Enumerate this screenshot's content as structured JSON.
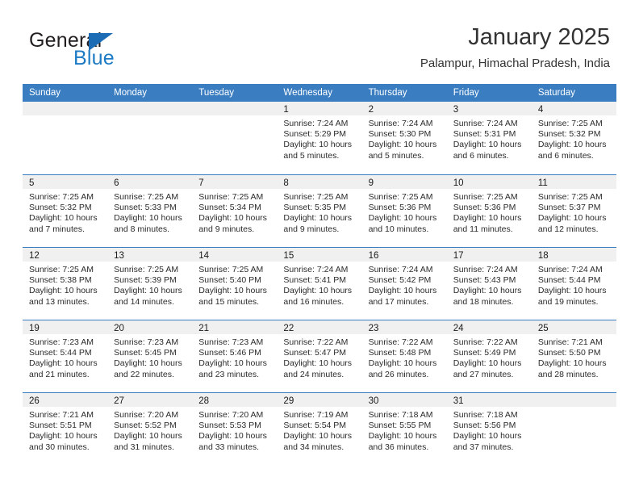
{
  "brand": {
    "name_part1": "General",
    "name_part2": "Blue",
    "triangle_color": "#1b6bb5",
    "blue_color": "#1c7bc4"
  },
  "header": {
    "month_title": "January 2025",
    "location": "Palampur, Himachal Pradesh, India"
  },
  "theme": {
    "header_blue": "#3a7dc1",
    "date_band_gray": "#f0f0f0",
    "text_color": "#2b2b2b"
  },
  "weekdays": [
    "Sunday",
    "Monday",
    "Tuesday",
    "Wednesday",
    "Thursday",
    "Friday",
    "Saturday"
  ],
  "weeks": [
    [
      {
        "date": "",
        "empty": true,
        "sunrise": "",
        "sunset": "",
        "daylight_line1": "",
        "daylight_line2": ""
      },
      {
        "date": "",
        "empty": true,
        "sunrise": "",
        "sunset": "",
        "daylight_line1": "",
        "daylight_line2": ""
      },
      {
        "date": "",
        "empty": true,
        "sunrise": "",
        "sunset": "",
        "daylight_line1": "",
        "daylight_line2": ""
      },
      {
        "date": "1",
        "empty": false,
        "sunrise": "Sunrise: 7:24 AM",
        "sunset": "Sunset: 5:29 PM",
        "daylight_line1": "Daylight: 10 hours",
        "daylight_line2": "and 5 minutes."
      },
      {
        "date": "2",
        "empty": false,
        "sunrise": "Sunrise: 7:24 AM",
        "sunset": "Sunset: 5:30 PM",
        "daylight_line1": "Daylight: 10 hours",
        "daylight_line2": "and 5 minutes."
      },
      {
        "date": "3",
        "empty": false,
        "sunrise": "Sunrise: 7:24 AM",
        "sunset": "Sunset: 5:31 PM",
        "daylight_line1": "Daylight: 10 hours",
        "daylight_line2": "and 6 minutes."
      },
      {
        "date": "4",
        "empty": false,
        "sunrise": "Sunrise: 7:25 AM",
        "sunset": "Sunset: 5:32 PM",
        "daylight_line1": "Daylight: 10 hours",
        "daylight_line2": "and 6 minutes."
      }
    ],
    [
      {
        "date": "5",
        "empty": false,
        "sunrise": "Sunrise: 7:25 AM",
        "sunset": "Sunset: 5:32 PM",
        "daylight_line1": "Daylight: 10 hours",
        "daylight_line2": "and 7 minutes."
      },
      {
        "date": "6",
        "empty": false,
        "sunrise": "Sunrise: 7:25 AM",
        "sunset": "Sunset: 5:33 PM",
        "daylight_line1": "Daylight: 10 hours",
        "daylight_line2": "and 8 minutes."
      },
      {
        "date": "7",
        "empty": false,
        "sunrise": "Sunrise: 7:25 AM",
        "sunset": "Sunset: 5:34 PM",
        "daylight_line1": "Daylight: 10 hours",
        "daylight_line2": "and 9 minutes."
      },
      {
        "date": "8",
        "empty": false,
        "sunrise": "Sunrise: 7:25 AM",
        "sunset": "Sunset: 5:35 PM",
        "daylight_line1": "Daylight: 10 hours",
        "daylight_line2": "and 9 minutes."
      },
      {
        "date": "9",
        "empty": false,
        "sunrise": "Sunrise: 7:25 AM",
        "sunset": "Sunset: 5:36 PM",
        "daylight_line1": "Daylight: 10 hours",
        "daylight_line2": "and 10 minutes."
      },
      {
        "date": "10",
        "empty": false,
        "sunrise": "Sunrise: 7:25 AM",
        "sunset": "Sunset: 5:36 PM",
        "daylight_line1": "Daylight: 10 hours",
        "daylight_line2": "and 11 minutes."
      },
      {
        "date": "11",
        "empty": false,
        "sunrise": "Sunrise: 7:25 AM",
        "sunset": "Sunset: 5:37 PM",
        "daylight_line1": "Daylight: 10 hours",
        "daylight_line2": "and 12 minutes."
      }
    ],
    [
      {
        "date": "12",
        "empty": false,
        "sunrise": "Sunrise: 7:25 AM",
        "sunset": "Sunset: 5:38 PM",
        "daylight_line1": "Daylight: 10 hours",
        "daylight_line2": "and 13 minutes."
      },
      {
        "date": "13",
        "empty": false,
        "sunrise": "Sunrise: 7:25 AM",
        "sunset": "Sunset: 5:39 PM",
        "daylight_line1": "Daylight: 10 hours",
        "daylight_line2": "and 14 minutes."
      },
      {
        "date": "14",
        "empty": false,
        "sunrise": "Sunrise: 7:25 AM",
        "sunset": "Sunset: 5:40 PM",
        "daylight_line1": "Daylight: 10 hours",
        "daylight_line2": "and 15 minutes."
      },
      {
        "date": "15",
        "empty": false,
        "sunrise": "Sunrise: 7:24 AM",
        "sunset": "Sunset: 5:41 PM",
        "daylight_line1": "Daylight: 10 hours",
        "daylight_line2": "and 16 minutes."
      },
      {
        "date": "16",
        "empty": false,
        "sunrise": "Sunrise: 7:24 AM",
        "sunset": "Sunset: 5:42 PM",
        "daylight_line1": "Daylight: 10 hours",
        "daylight_line2": "and 17 minutes."
      },
      {
        "date": "17",
        "empty": false,
        "sunrise": "Sunrise: 7:24 AM",
        "sunset": "Sunset: 5:43 PM",
        "daylight_line1": "Daylight: 10 hours",
        "daylight_line2": "and 18 minutes."
      },
      {
        "date": "18",
        "empty": false,
        "sunrise": "Sunrise: 7:24 AM",
        "sunset": "Sunset: 5:44 PM",
        "daylight_line1": "Daylight: 10 hours",
        "daylight_line2": "and 19 minutes."
      }
    ],
    [
      {
        "date": "19",
        "empty": false,
        "sunrise": "Sunrise: 7:23 AM",
        "sunset": "Sunset: 5:44 PM",
        "daylight_line1": "Daylight: 10 hours",
        "daylight_line2": "and 21 minutes."
      },
      {
        "date": "20",
        "empty": false,
        "sunrise": "Sunrise: 7:23 AM",
        "sunset": "Sunset: 5:45 PM",
        "daylight_line1": "Daylight: 10 hours",
        "daylight_line2": "and 22 minutes."
      },
      {
        "date": "21",
        "empty": false,
        "sunrise": "Sunrise: 7:23 AM",
        "sunset": "Sunset: 5:46 PM",
        "daylight_line1": "Daylight: 10 hours",
        "daylight_line2": "and 23 minutes."
      },
      {
        "date": "22",
        "empty": false,
        "sunrise": "Sunrise: 7:22 AM",
        "sunset": "Sunset: 5:47 PM",
        "daylight_line1": "Daylight: 10 hours",
        "daylight_line2": "and 24 minutes."
      },
      {
        "date": "23",
        "empty": false,
        "sunrise": "Sunrise: 7:22 AM",
        "sunset": "Sunset: 5:48 PM",
        "daylight_line1": "Daylight: 10 hours",
        "daylight_line2": "and 26 minutes."
      },
      {
        "date": "24",
        "empty": false,
        "sunrise": "Sunrise: 7:22 AM",
        "sunset": "Sunset: 5:49 PM",
        "daylight_line1": "Daylight: 10 hours",
        "daylight_line2": "and 27 minutes."
      },
      {
        "date": "25",
        "empty": false,
        "sunrise": "Sunrise: 7:21 AM",
        "sunset": "Sunset: 5:50 PM",
        "daylight_line1": "Daylight: 10 hours",
        "daylight_line2": "and 28 minutes."
      }
    ],
    [
      {
        "date": "26",
        "empty": false,
        "sunrise": "Sunrise: 7:21 AM",
        "sunset": "Sunset: 5:51 PM",
        "daylight_line1": "Daylight: 10 hours",
        "daylight_line2": "and 30 minutes."
      },
      {
        "date": "27",
        "empty": false,
        "sunrise": "Sunrise: 7:20 AM",
        "sunset": "Sunset: 5:52 PM",
        "daylight_line1": "Daylight: 10 hours",
        "daylight_line2": "and 31 minutes."
      },
      {
        "date": "28",
        "empty": false,
        "sunrise": "Sunrise: 7:20 AM",
        "sunset": "Sunset: 5:53 PM",
        "daylight_line1": "Daylight: 10 hours",
        "daylight_line2": "and 33 minutes."
      },
      {
        "date": "29",
        "empty": false,
        "sunrise": "Sunrise: 7:19 AM",
        "sunset": "Sunset: 5:54 PM",
        "daylight_line1": "Daylight: 10 hours",
        "daylight_line2": "and 34 minutes."
      },
      {
        "date": "30",
        "empty": false,
        "sunrise": "Sunrise: 7:18 AM",
        "sunset": "Sunset: 5:55 PM",
        "daylight_line1": "Daylight: 10 hours",
        "daylight_line2": "and 36 minutes."
      },
      {
        "date": "31",
        "empty": false,
        "sunrise": "Sunrise: 7:18 AM",
        "sunset": "Sunset: 5:56 PM",
        "daylight_line1": "Daylight: 10 hours",
        "daylight_line2": "and 37 minutes."
      },
      {
        "date": "",
        "empty": true,
        "sunrise": "",
        "sunset": "",
        "daylight_line1": "",
        "daylight_line2": ""
      }
    ]
  ]
}
